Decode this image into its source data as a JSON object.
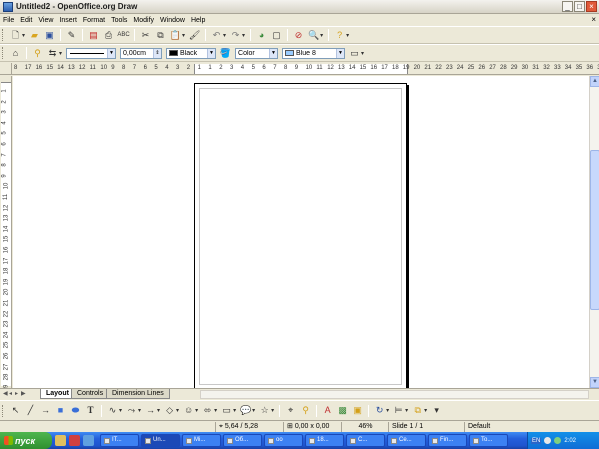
{
  "window": {
    "title": "Untitled2 - OpenOffice.org Draw"
  },
  "menu": [
    "File",
    "Edit",
    "View",
    "Insert",
    "Format",
    "Tools",
    "Modify",
    "Window",
    "Help"
  ],
  "line_style": {
    "width_value": "0,00cm",
    "color_name": "Black",
    "color_hex": "#000000",
    "fill_type": "Color",
    "fill_color_name": "Blue 8",
    "fill_color_hex": "#99ccff"
  },
  "ruler": {
    "horizontal_ticks": [
      "8",
      "17",
      "16",
      "15",
      "14",
      "13",
      "12",
      "11",
      "10",
      "9",
      "8",
      "7",
      "6",
      "5",
      "4",
      "3",
      "2",
      "1",
      "1",
      "2",
      "3",
      "4",
      "5",
      "6",
      "7",
      "8",
      "9",
      "10",
      "11",
      "12",
      "13",
      "14",
      "15",
      "16",
      "17",
      "18",
      "19",
      "20",
      "21",
      "22",
      "23",
      "24",
      "25",
      "26",
      "27",
      "28",
      "29",
      "30",
      "31",
      "32",
      "33",
      "34",
      "35",
      "36",
      "37",
      "38"
    ],
    "vertical_ticks": [
      "1",
      "2",
      "3",
      "4",
      "5",
      "6",
      "7",
      "8",
      "9",
      "10",
      "11",
      "12",
      "13",
      "14",
      "15",
      "16",
      "17",
      "18",
      "19",
      "20",
      "21",
      "22",
      "23",
      "24",
      "25",
      "26",
      "27",
      "28",
      "29"
    ]
  },
  "tabs": [
    {
      "label": "Layout",
      "active": true
    },
    {
      "label": "Controls",
      "active": false
    },
    {
      "label": "Dimension Lines",
      "active": false
    }
  ],
  "status": {
    "position": "5,64 / 5,28",
    "size": "0,00 x 0,00",
    "zoom": "46%",
    "slide": "Slide 1 / 1",
    "layout": "Default"
  },
  "taskbar": {
    "start_label": "пуск",
    "tasks": [
      "IT...",
      "Un...",
      "Mi...",
      "Об...",
      "oo",
      "18...",
      "C...",
      "Се...",
      "Fin...",
      "To..."
    ],
    "active_task_index": 1,
    "lang": "EN",
    "clock": "2:02"
  }
}
